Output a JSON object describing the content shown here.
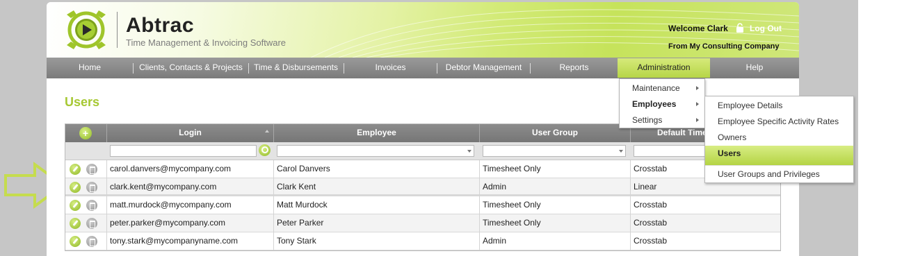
{
  "header": {
    "brand": "Abtrac",
    "tagline": "Time Management & Invoicing Software",
    "welcome": "Welcome Clark",
    "logout": "Log Out",
    "company": "From My Consulting Company",
    "accent_color": "#a6c833"
  },
  "nav": {
    "items": [
      {
        "label": "Home"
      },
      {
        "label": "Clients, Contacts & Projects"
      },
      {
        "label": "Time & Disbursements"
      },
      {
        "label": "Invoices"
      },
      {
        "label": "Debtor Management"
      },
      {
        "label": "Reports"
      },
      {
        "label": "Administration",
        "active": true
      },
      {
        "label": "Help"
      }
    ]
  },
  "page": {
    "title": "Users"
  },
  "grid": {
    "columns": [
      "Login",
      "Employee",
      "User Group",
      "Default Time"
    ],
    "add_icon": "plus-icon",
    "rows": [
      {
        "login": "carol.danvers@mycompany.com",
        "employee": "Carol Danvers",
        "group": "Timesheet Only",
        "time": "Crosstab"
      },
      {
        "login": "clark.kent@mycompany.com",
        "employee": "Clark Kent",
        "group": "Admin",
        "time": "Linear"
      },
      {
        "login": "matt.murdock@mycompany.com",
        "employee": "Matt Murdock",
        "group": "Timesheet Only",
        "time": "Crosstab"
      },
      {
        "login": "peter.parker@mycompany.com",
        "employee": "Peter Parker",
        "group": "Timesheet Only",
        "time": "Crosstab"
      },
      {
        "login": "tony.stark@mycompanyname.com",
        "employee": "Tony Stark",
        "group": "Admin",
        "time": "Crosstab"
      }
    ]
  },
  "menu": {
    "level1": [
      {
        "label": "Maintenance"
      },
      {
        "label": "Employees",
        "bold": true
      },
      {
        "label": "Settings"
      }
    ],
    "level2": [
      {
        "label": "Employee Details"
      },
      {
        "label": "Employee Specific Activity Rates"
      },
      {
        "label": "Owners"
      },
      {
        "label": "Users",
        "active": true
      },
      {
        "label": "User Groups and Privileges"
      }
    ]
  }
}
